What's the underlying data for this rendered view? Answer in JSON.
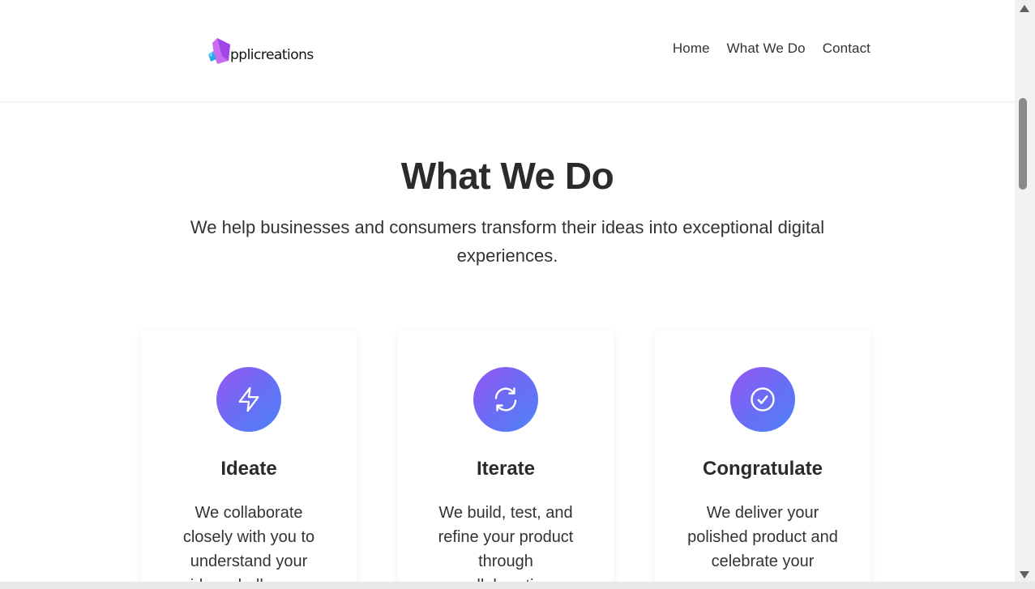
{
  "header": {
    "logo_text": "pplicreations",
    "nav": [
      {
        "label": "Home"
      },
      {
        "label": "What We Do"
      },
      {
        "label": "Contact"
      }
    ]
  },
  "hero": {
    "title": "What We Do",
    "subtitle": "We help businesses and consumers transform their ideas into exceptional digital experiences."
  },
  "cards": [
    {
      "icon": "lightning-bolt-icon",
      "title": "Ideate",
      "text": "We collaborate closely with you to understand your idea, challenges"
    },
    {
      "icon": "refresh-icon",
      "title": "Iterate",
      "text": "We build, test, and refine your product through collaboration"
    },
    {
      "icon": "check-circle-icon",
      "title": "Congratulate",
      "text": "We deliver your polished product and celebrate your success"
    }
  ],
  "colors": {
    "accent_gradient_start": "#9656f2",
    "accent_gradient_end": "#4e83f7",
    "text": "#2b2b2b"
  }
}
